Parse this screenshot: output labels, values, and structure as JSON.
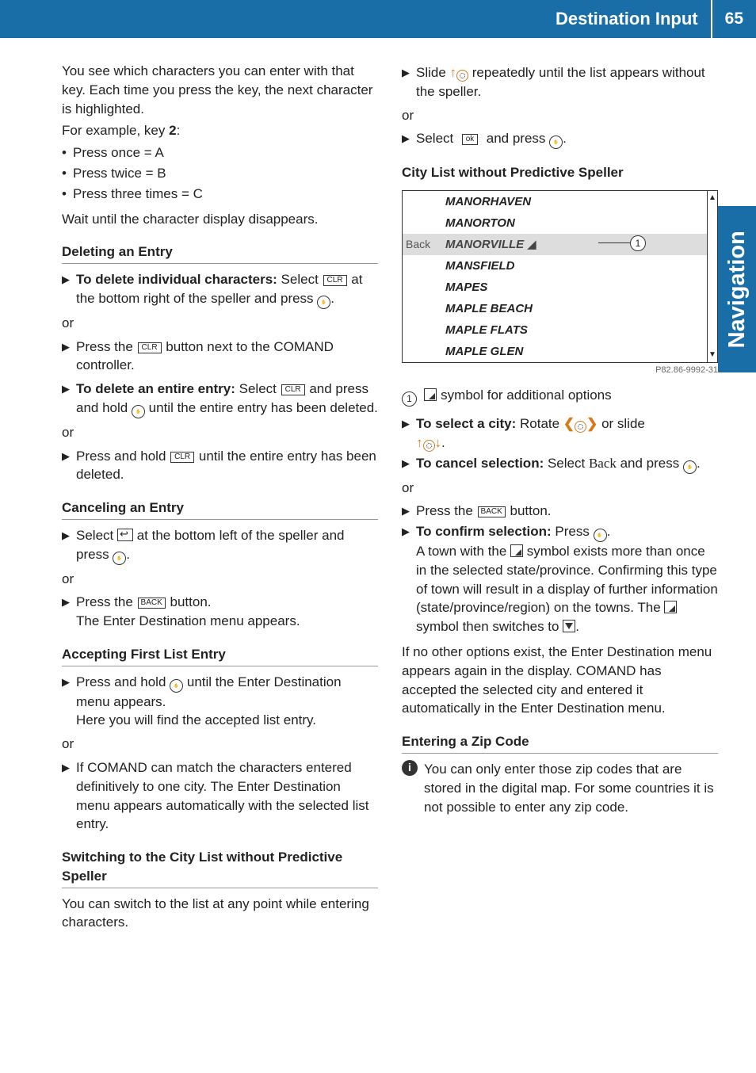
{
  "header": {
    "title": "Destination Input",
    "page": "65"
  },
  "sideTab": "Navigation",
  "left": {
    "p1": "You see which characters you can enter with that key. Each time you press the key, the next character is highlighted.",
    "exampleIntro": "For example, key ",
    "exampleKey": "2",
    "exampleColon": ":",
    "b1": "Press once = A",
    "b2": "Press twice = B",
    "b3": "Press three times = C",
    "p2": "Wait until the character display disappears.",
    "h1": "Deleting an Entry",
    "d1a": "To delete individual characters:",
    "d1b": " Select ",
    "d1c": " at the bottom right of the speller and press ",
    "or": "or",
    "d2a": "Press the ",
    "d2b": " button next to the COMAND controller.",
    "d3a": "To delete an entire entry:",
    "d3b": " Select ",
    "d3c": " and press and hold ",
    "d3d": " until the entire entry has been deleted.",
    "d4a": "Press and hold ",
    "d4b": " until the entire entry has been deleted.",
    "h2": "Canceling an Entry",
    "c1a": "Select ",
    "c1b": " at the bottom left of the speller and press ",
    "c2a": "Press the ",
    "c2b": " button.",
    "c2c": "The Enter Destination menu appears.",
    "h3": "Accepting First List Entry",
    "a1a": "Press and hold ",
    "a1b": " until the Enter Destination menu appears.",
    "a1c": "Here you will find the accepted list entry.",
    "a2": "If COMAND can match the characters entered definitively to one city. The Enter Destination menu appears automatically with the selected list entry.",
    "h4": "Switching to the City List without Predictive Speller",
    "s1": "You can switch to the list at any point while entering characters."
  },
  "right": {
    "r1a": "Slide ",
    "r1b": " repeatedly until the list appears without the speller.",
    "or": "or",
    "r2a": "Select ",
    "r2b": " and press ",
    "h1": "City List without Predictive Speller",
    "cityList": {
      "back": "Back",
      "items": [
        "MANORHAVEN",
        "MANORTON",
        "MANORVILLE",
        "MANSFIELD",
        "MAPES",
        "MAPLE BEACH",
        "MAPLE FLATS",
        "MAPLE GLEN"
      ]
    },
    "figId": "P82.86-9992-31",
    "legend1": " symbol for additional options",
    "t1a": "To select a city:",
    "t1b": " Rotate ",
    "t1c": " or slide ",
    "t2a": "To cancel selection:",
    "t2b": " Select ",
    "t2c": "Back",
    "t2d": " and press ",
    "t3a": "Press the ",
    "t3b": " button.",
    "t4a": "To confirm selection:",
    "t4b": " Press ",
    "t4c": "A town with the ",
    "t4d": " symbol exists more than once in the selected state/province. Confirming this type of town will result in a display of further information (state/province/region) on the towns. The ",
    "t4e": " symbol then switches to ",
    "p3": "If no other options exist, the Enter Destination menu appears again in the display. COMAND has accepted the selected city and entered it automatically in the Enter Destination menu.",
    "h2": "Entering a Zip Code",
    "info": "You can only enter those zip codes that are stored in the digital map. For some countries it is not possible to enter any zip code."
  },
  "keys": {
    "clr": "CLR",
    "back": "BACK",
    "ok": "ok"
  }
}
